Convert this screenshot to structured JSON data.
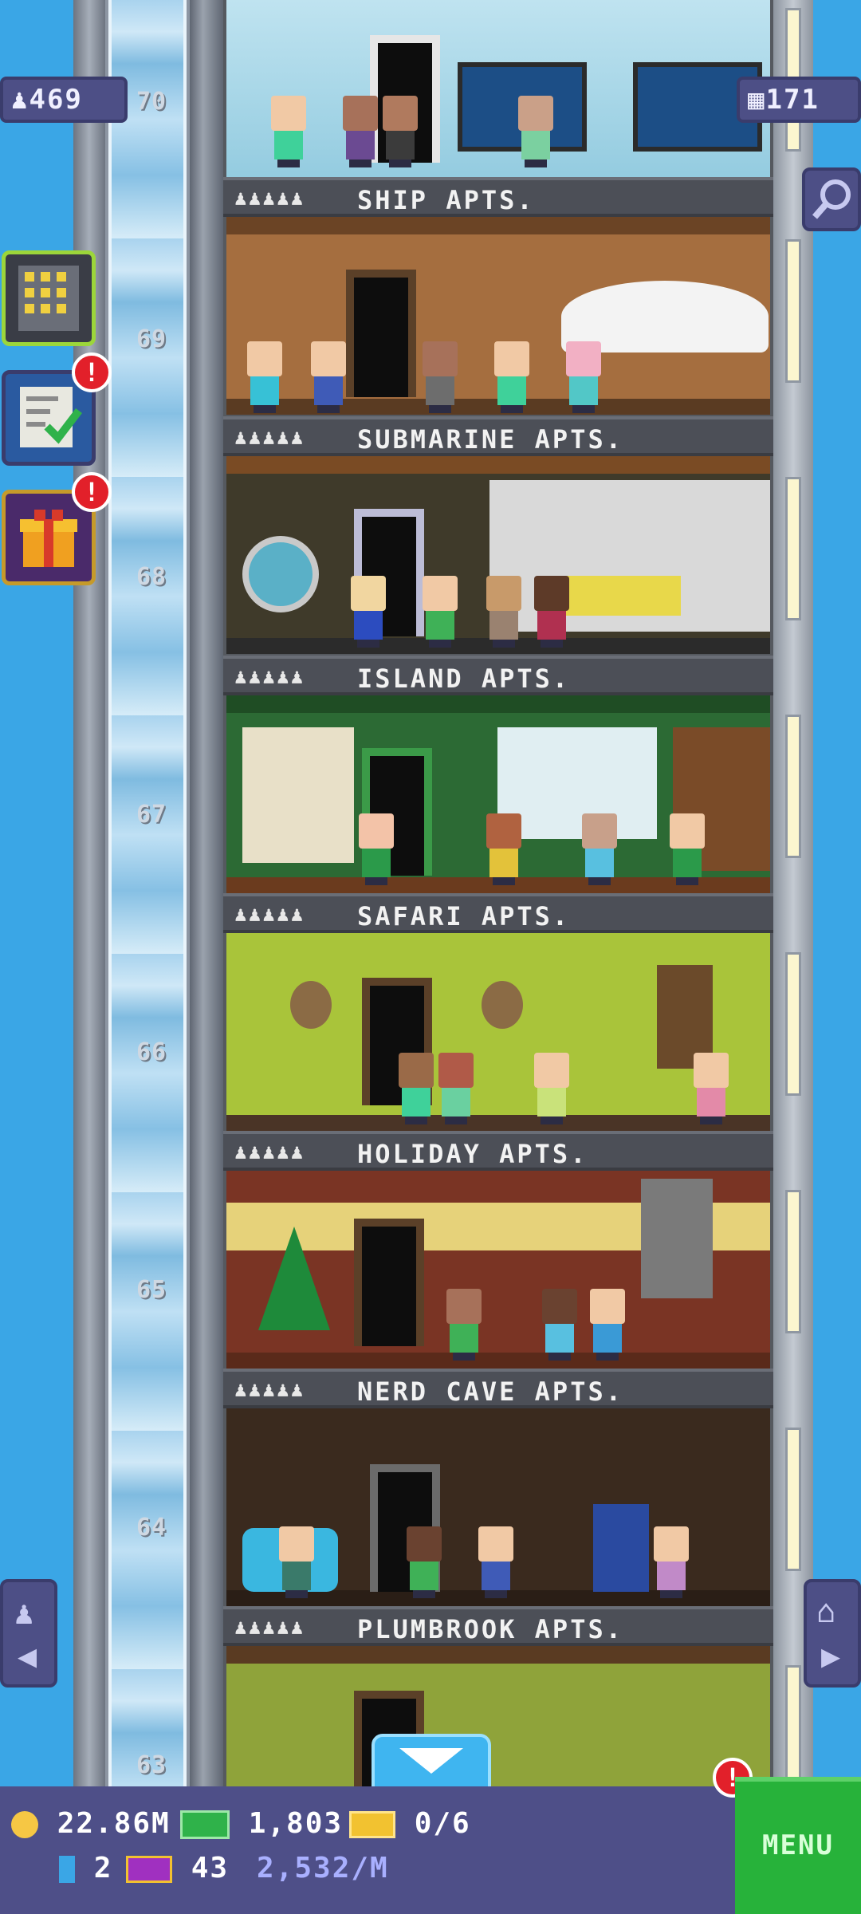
{
  "hud": {
    "population": "469",
    "floors_count": "171"
  },
  "floors": [
    {
      "number": "70",
      "label": "SHIP APTS."
    },
    {
      "number": "69",
      "label": "SUBMARINE APTS."
    },
    {
      "number": "68",
      "label": "ISLAND APTS."
    },
    {
      "number": "67",
      "label": "SAFARI APTS."
    },
    {
      "number": "66",
      "label": "HOLIDAY APTS."
    },
    {
      "number": "65",
      "label": "NERD CAVE APTS."
    },
    {
      "number": "64",
      "label": "PLUMBROOK APTS."
    },
    {
      "number": "63",
      "label": ""
    }
  ],
  "stars_glyph": "♟♟♟♟♟",
  "badges": {
    "missions": "!",
    "gift": "!",
    "bottom": "!"
  },
  "bottom": {
    "coins": "22.86M",
    "bux": "1,803",
    "vip_tickets": "0/6",
    "elevator_upgrades": "2",
    "special": "43",
    "rate": "2,532/M",
    "menu_label": "MENU"
  },
  "colors": {
    "sky": "#3aa6e6",
    "hud_purple": "#4d4f86",
    "menu_green": "#27b23a",
    "badge_red": "#e2202a"
  }
}
